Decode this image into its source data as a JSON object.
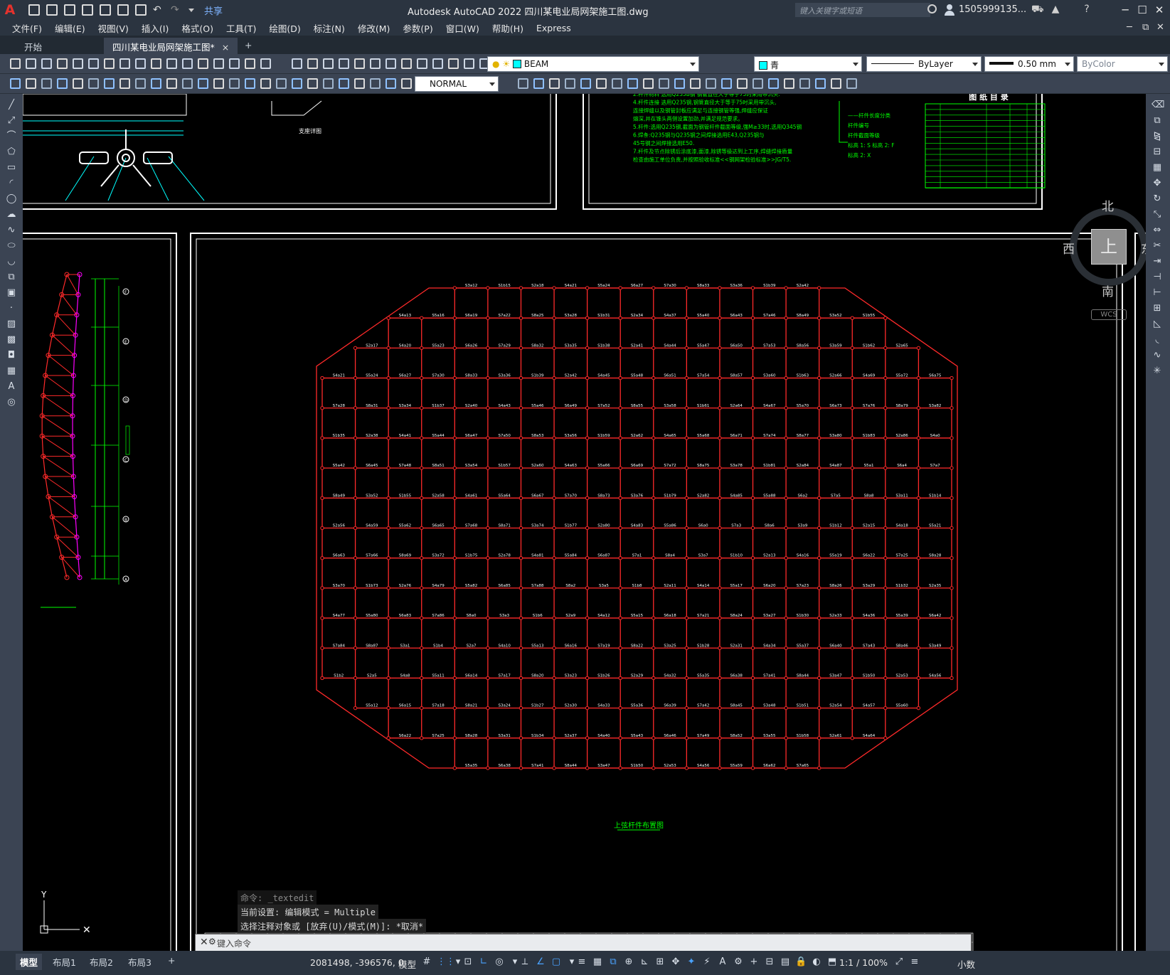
{
  "app": {
    "logo": "A",
    "title": "Autodesk AutoCAD 2022    四川某电业局网架施工图.dwg",
    "share_label": "共享",
    "search_placeholder": "键入关键字或短语",
    "username": "1505999135...",
    "window_controls": [
      "minimize-icon",
      "maximize-icon",
      "close-icon"
    ]
  },
  "menu": {
    "items": [
      "文件(F)",
      "编辑(E)",
      "视图(V)",
      "插入(I)",
      "格式(O)",
      "工具(T)",
      "绘图(D)",
      "标注(N)",
      "修改(M)",
      "参数(P)",
      "窗口(W)",
      "帮助(H)",
      "Express"
    ]
  },
  "tabs": {
    "start": "开始",
    "document": "四川某电业局网架施工图*",
    "close": "×",
    "new": "+"
  },
  "properties": {
    "layer": "BEAM",
    "color": "青",
    "color_hex": "#00ffff",
    "linetype": "ByLayer",
    "lineweight": "0.50 mm",
    "plotstyle": "ByColor",
    "textstyle": "NORMAL"
  },
  "viewcube": {
    "north": "北",
    "south": "南",
    "east": "东",
    "west": "西",
    "face": "上",
    "wcs": "WCS"
  },
  "drawing": {
    "caption": "上弦杆件布置图",
    "index_title": "图 纸 目 录",
    "notes": [
      "2.杆件材料 选用Q235B钢 钢管直径大于等于75时采用带沉头.",
      "4.杆件连接 选用Q235钢,钢管直径大于等于75时采用带沉头,",
      "  连接焊缝以及钢管封板应满足与连接钢管等强,焊缝应保证",
      "  熔深,并在锥头两侧设置加劲,并满足规范要求。",
      "5.杆件:选用Q235钢,截面为钢管杆件截面等级,强M≥33时,选用Q345钢",
      "6.焊条:Q235钢与Q235钢之间焊接选用E43,Q235钢与",
      "  45号钢之间焊接选用E50.",
      "7.杆件及节点除锈后涂底漆,面漆,除锈等级达到上工序,焊缝焊接质量",
      "  检查由施工单位负责,并按照验收标准<<钢网架检验标准>>JG/T5."
    ],
    "legend": [
      "——杆件长度分类",
      "杆件编号",
      "杆件截面等级",
      "标高 1: S  标高 2: F",
      "标高 2: X"
    ]
  },
  "command": {
    "history": [
      "命令: _textedit",
      "当前设置: 编辑模式 = Multiple",
      "选择注释对象或 [放弃(U)/模式(M)]: *取消*"
    ],
    "prompt": "键入命令"
  },
  "status": {
    "layouts": [
      "模型",
      "布局1",
      "布局2",
      "布局3"
    ],
    "add_layout": "+",
    "coordinates": "2081498, -396576, 0",
    "mode": "模型",
    "scale": "1:1 / 100%",
    "units": "小数"
  }
}
